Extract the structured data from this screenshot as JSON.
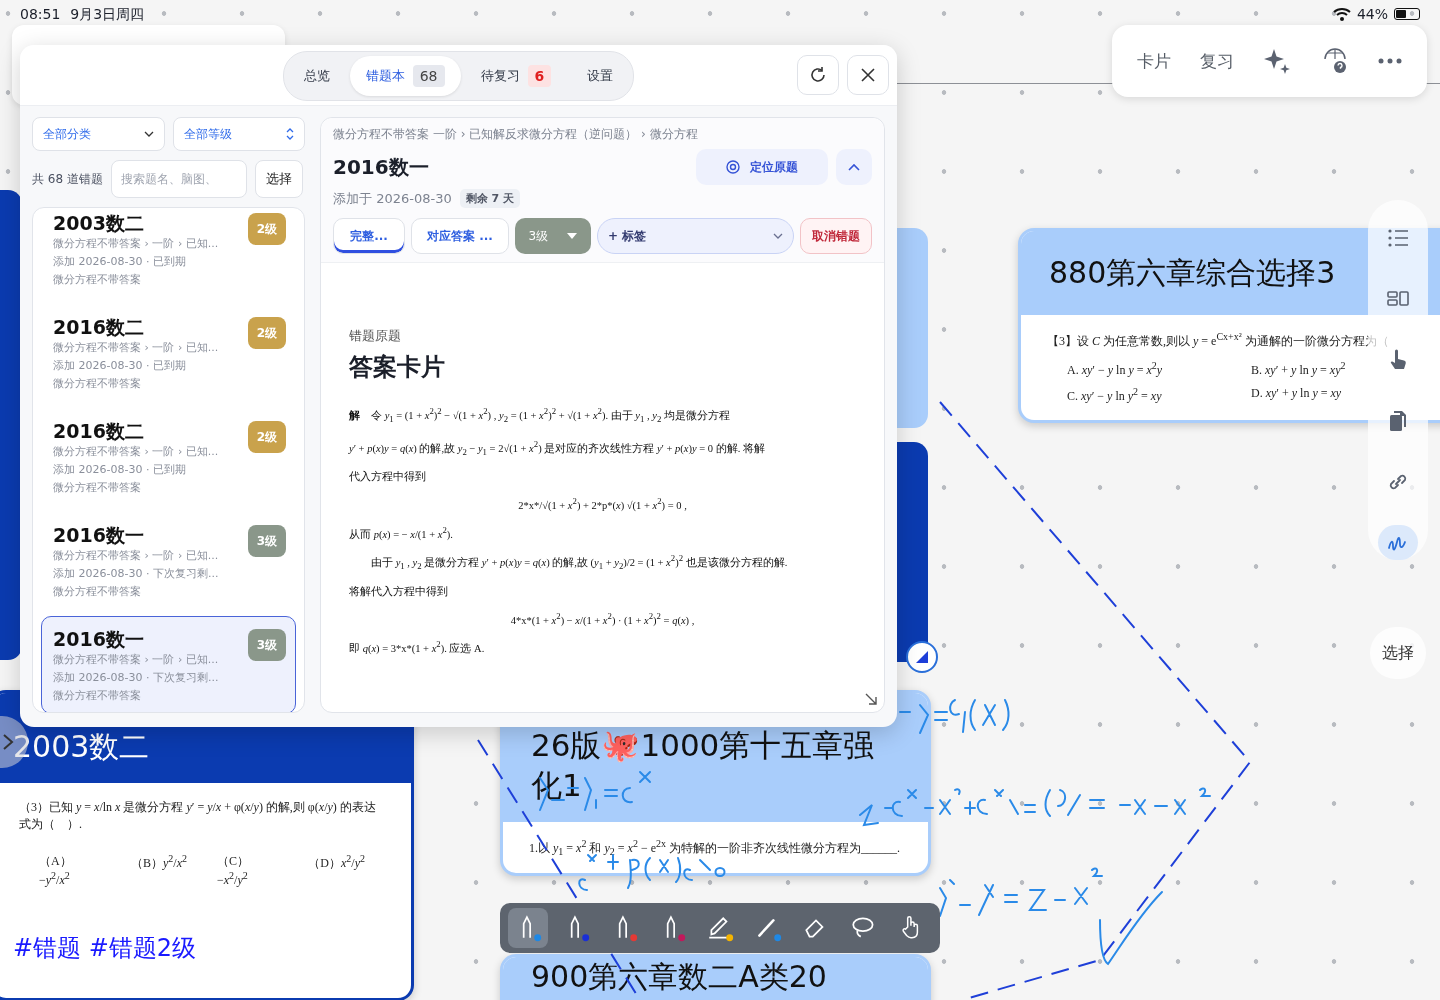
{
  "status_bar": {
    "time": "08:51",
    "date": "9月3日周四",
    "battery": "44%"
  },
  "top_toolbar": {
    "items": [
      {
        "kind": "text",
        "label": "卡片"
      },
      {
        "kind": "text",
        "label": "复习"
      },
      {
        "kind": "sparkle"
      },
      {
        "kind": "web-help"
      },
      {
        "kind": "more"
      }
    ]
  },
  "side_toolbar": {
    "items": [
      {
        "kind": "list",
        "selected": false
      },
      {
        "kind": "layout",
        "selected": false
      },
      {
        "kind": "pointer",
        "selected": false
      },
      {
        "kind": "copy",
        "selected": false
      },
      {
        "kind": "link",
        "selected": false
      },
      {
        "kind": "ink",
        "selected": true
      }
    ],
    "select_label": "选择"
  },
  "canvas_cards": [
    {
      "kind": "light",
      "title": "880第六章综合选择3",
      "problem": "【3】设 *C* 为任意常数,则以 *y* = e$^{Cx+x²}$ 为通解的一阶微分方程为（",
      "options": [
        "A. *xy*′ − *y* ln *y* = *x*$^{2}$*y*",
        "B. *xy*′ + *y* ln *y* = *xy*$^{2}$",
        "C. *xy*′ − *y* ln *y*$^{2}$ = *xy*",
        "D. *xy*′ + *y* ln *y* = *xy*"
      ]
    },
    {
      "kind": "dark",
      "title": "2003数二",
      "problem": "（3）已知 *y* = *x*/ln *x* 是微分方程 *y*′ = *y*/*x* + φ(*x*/*y*) 的解,则 φ(*x*/*y*) 的表达式为（　）.",
      "options": [
        "（A）−*y*$^{2}$/*x*$^{2}$",
        "（B）*y*$^{2}$/*x*$^{2}$",
        "（C）−*x*$^{2}$/*y*$^{2}$",
        "（D）*x*$^{2}$/*y*$^{2}$"
      ],
      "tags": "#错题 #错题2级"
    },
    {
      "kind": "light",
      "title": "26版🐙1000第十五章强化1",
      "problem": "1.以 *y*$_{1}$ = *x*$^{2}$ 和 *y*$_{2}$ = *x*$^{2}$ − e$^{2x}$ 为特解的一阶非齐次线性微分方程为______."
    },
    {
      "kind": "light",
      "title": "900第六章数二A类20"
    }
  ],
  "pen_toolbar": {
    "tools": [
      {
        "kind": "pen",
        "color": "#1e88e5",
        "selected": true
      },
      {
        "kind": "pen",
        "color": "#1a2fd6",
        "selected": false
      },
      {
        "kind": "pen",
        "color": "#e53935",
        "selected": false
      },
      {
        "kind": "pen",
        "color": "#c2185b",
        "selected": false
      },
      {
        "kind": "highlighter",
        "color": "#f4b400",
        "selected": false
      },
      {
        "kind": "pencil",
        "color": "#1e88e5",
        "selected": false
      },
      {
        "kind": "eraser",
        "selected": false
      },
      {
        "kind": "lasso",
        "selected": false
      },
      {
        "kind": "hand",
        "selected": false
      }
    ]
  },
  "panel": {
    "tabs": [
      {
        "label": "总览",
        "selected": false
      },
      {
        "label": "错题本",
        "count": "68",
        "alert": false,
        "selected": true
      },
      {
        "label": "待复习",
        "count": "6",
        "alert": true,
        "selected": false
      },
      {
        "label": "设置",
        "selected": false
      }
    ],
    "filters": {
      "category": "全部分类",
      "level": "全部等级"
    },
    "count_label": "共 68 道错题",
    "search": {
      "placeholder": "搜索题名、脑图、"
    },
    "select_button": "选择",
    "items": [
      {
        "title": "2003数二",
        "path": "微分方程不带答案 › 一阶 › 已知...",
        "meta": "添加 2026-08-30 · 已到期",
        "tag": "微分方程不带答案",
        "level": "2级",
        "color": "#c9a24c",
        "selected": false
      },
      {
        "title": "2016数二",
        "path": "微分方程不带答案 › 一阶 › 已知...",
        "meta": "添加 2026-08-30 · 已到期",
        "tag": "微分方程不带答案",
        "level": "2级",
        "color": "#c9a24c",
        "selected": false
      },
      {
        "title": "2016数二",
        "path": "微分方程不带答案 › 一阶 › 已知...",
        "meta": "添加 2026-08-30 · 已到期",
        "tag": "微分方程不带答案",
        "level": "2级",
        "color": "#c9a24c",
        "selected": false
      },
      {
        "title": "2016数一",
        "path": "微分方程不带答案 › 一阶 › 已知...",
        "meta": "添加 2026-08-30 · 下次复习剩...",
        "tag": "微分方程不带答案",
        "level": "3级",
        "color": "#8a978a",
        "selected": false
      },
      {
        "title": "2016数一",
        "path": "微分方程不带答案 › 一阶 › 已知...",
        "meta": "添加 2026-08-30 · 下次复习剩...",
        "tag": "微分方程不带答案",
        "level": "3级",
        "color": "#8a978a",
        "selected": true
      }
    ],
    "detail": {
      "breadcrumb": "微分方程不带答案  一阶 › 已知解反求微分方程（逆问题） › 微分方程",
      "title": "2016数一",
      "locate_button": "定位原题",
      "added": "添加于 2026-08-30",
      "remaining": "剩余 7 天",
      "view_tabs": [
        {
          "label": "完整...",
          "selected": true
        },
        {
          "label": "对应答案 ...",
          "selected": false
        }
      ],
      "level": {
        "label": "3级",
        "color": "#8a978a"
      },
      "tag_button": "+ 标签",
      "remove_button": "取消错题",
      "section_label": "错题原题",
      "card_heading": "答案卡片",
      "solution": [
        {
          "kind": "inline",
          "text": "**解**　令 *y*$_{1}$ = (1 + *x*$^{2}$)$^{2}$ − √(1 + *x*$^{2}$) , *y*$_{2}$ = (1 + *x*$^{2}$)$^{2}$ + √(1 + *x*$^{2}$). 由于 *y*$_{1}$ , *y*$_{2}$ 均是微分方程"
        },
        {
          "kind": "inline",
          "text": "*y*′ + *p*(*x*)*y* = *q*(*x*) 的解,故 *y*$_{2}$ − *y*$_{1}$ = 2√(1 + *x*$^{2}$) 是对应的齐次线性方程 *y*′ + *p*(*x*)*y* = 0 的解. 将解"
        },
        {
          "kind": "inline",
          "text": "代入方程中得到"
        },
        {
          "kind": "display",
          "text": "2*x*/√(1 + *x*$^{2}$) + 2*p*(*x*) √(1 + *x*$^{2}$) = 0 ,"
        },
        {
          "kind": "inline",
          "text": "从而 *p*(*x*) = − *x*/(1 + *x*$^{2}$)."
        },
        {
          "kind": "inline",
          "text": "　　由于 *y*$_{1}$ , *y*$_{2}$ 是微分方程 *y*′ + *p*(*x*)*y* = *q*(*x*) 的解,故 (*y*$_{1}$ + *y*$_{2}$)/2 = (1 + *x*$^{2}$)$^{2}$ 也是该微分方程的解."
        },
        {
          "kind": "inline",
          "text": "将解代入方程中得到"
        },
        {
          "kind": "display",
          "text": "4*x*(1 + *x*$^{2}$) − *x*/(1 + *x*$^{2}$) · (1 + *x*$^{2}$)$^{2}$ = *q*(*x*) ,"
        },
        {
          "kind": "inline",
          "text": "即 *q*(*x*) = 3*x*(1 + *x*$^{2}$). 应选 A."
        }
      ]
    }
  }
}
